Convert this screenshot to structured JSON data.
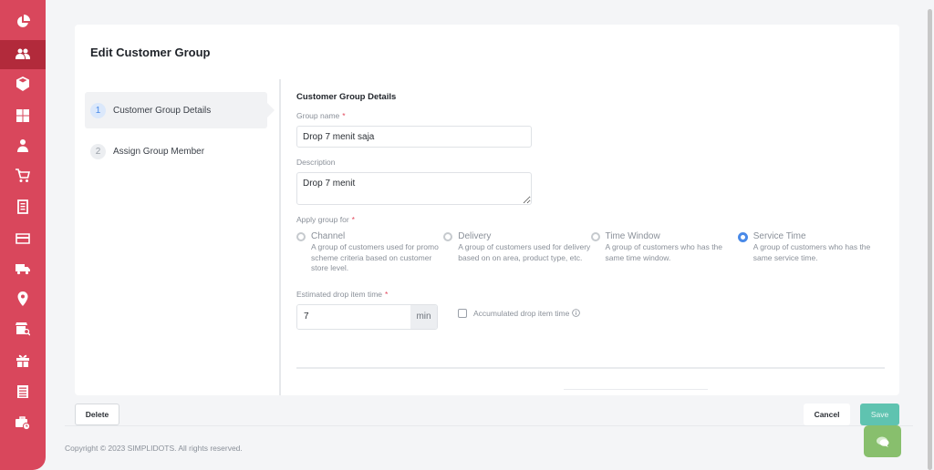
{
  "sidebar": {
    "items": [
      {
        "icon": "pie-chart-icon",
        "active": false
      },
      {
        "icon": "users-icon",
        "active": true
      },
      {
        "icon": "box-icon",
        "active": false
      },
      {
        "icon": "boxes-icon",
        "active": false
      },
      {
        "icon": "user-card-icon",
        "active": false
      },
      {
        "icon": "cart-icon",
        "active": false
      },
      {
        "icon": "receipt-icon",
        "active": false
      },
      {
        "icon": "credit-card-icon",
        "active": false
      },
      {
        "icon": "truck-icon",
        "active": false
      },
      {
        "icon": "location-pin-icon",
        "active": false
      },
      {
        "icon": "store-search-icon",
        "active": false
      },
      {
        "icon": "gift-icon",
        "active": false
      },
      {
        "icon": "list-document-icon",
        "active": false
      },
      {
        "icon": "briefcase-clock-icon",
        "active": false
      }
    ]
  },
  "page": {
    "title": "Edit Customer Group"
  },
  "steps": [
    {
      "number": "1",
      "label": "Customer Group Details",
      "active": true
    },
    {
      "number": "2",
      "label": "Assign Group Member",
      "active": false
    }
  ],
  "form": {
    "section_title": "Customer Group Details",
    "group_name": {
      "label": "Group name",
      "required": "*",
      "value": "Drop 7 menit saja"
    },
    "description": {
      "label": "Description",
      "value": "Drop 7 menit"
    },
    "apply_group": {
      "label": "Apply group for",
      "required": "*",
      "options": [
        {
          "title": "Channel",
          "desc": "A group of customers used for promo scheme criteria based on customer store level.",
          "checked": false
        },
        {
          "title": "Delivery",
          "desc": "A group of customers used for delivery based on on area, product type, etc.",
          "checked": false
        },
        {
          "title": "Time Window",
          "desc": "A group of customers who has the same time window.",
          "checked": false
        },
        {
          "title": "Service Time",
          "desc": "A group of customers who has the same service time.",
          "checked": true
        }
      ]
    },
    "drop_time": {
      "label": "Estimated drop item time",
      "required": "*",
      "value": "7",
      "suffix": "min"
    },
    "accumulated": {
      "label": "Accumulated drop item time",
      "checked": false
    }
  },
  "actions": {
    "delete": "Delete",
    "cancel": "Cancel",
    "save": "Save"
  },
  "footer": {
    "copyright": "Copyright © 2023 SIMPLIDOTS. All rights reserved."
  },
  "colors": {
    "sidebar": "#d9475c",
    "sidebar_active": "#b22a3b",
    "primary_blue": "#4a8ae8",
    "save_button": "#5fc3b0",
    "chat_button": "#88bf6d"
  }
}
